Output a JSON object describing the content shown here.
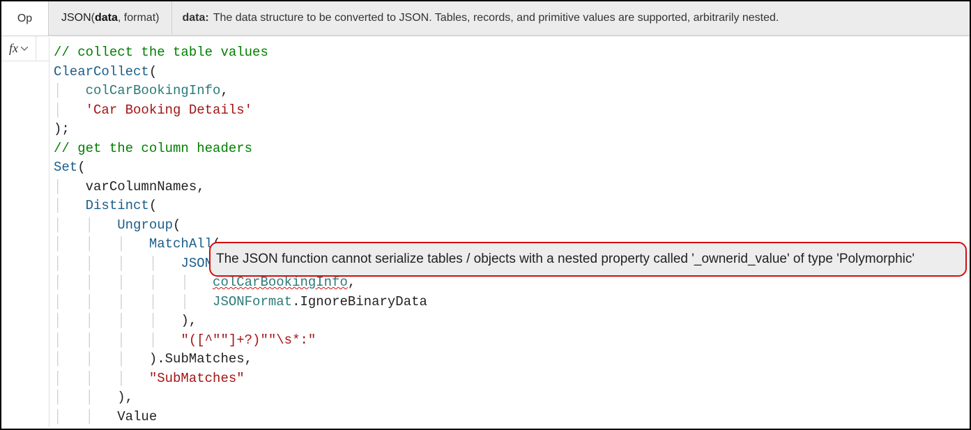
{
  "top": {
    "op_label": "Op",
    "signature_func": "JSON",
    "signature_bold_arg": "data",
    "signature_rest": ", format)",
    "param_label": "data:",
    "param_desc": "The data structure to be converted to JSON. Tables, records, and primitive values are supported, arbitrarily nested."
  },
  "fx": {
    "label": "fx"
  },
  "code": {
    "c1": "// collect the table values",
    "l2_fn": "ClearCollect",
    "l3_ident": "colCarBookingInfo",
    "l4_str": "'Car Booking Details'",
    "c6": "// get the column headers",
    "l7_fn": "Set",
    "l8_ident": "varColumnNames",
    "l9_fn": "Distinct",
    "l10_fn": "Ungroup",
    "l11_fn": "MatchAll",
    "l12_fn": "JSON",
    "l13_ident": "colCarBookingInfo",
    "l14_a": "JSONFormat",
    "l14_b": ".IgnoreBinaryData",
    "l16_str": "\"([^\"\"]+?)\"\"\\s*:\"",
    "l17_tail": ".SubMatches,",
    "l18_str": "\"SubMatches\"",
    "l20_ident": "Value"
  },
  "error": {
    "message": "The JSON function cannot serialize tables / objects with a nested property called '_ownerid_value' of type 'Polymorphic'"
  }
}
